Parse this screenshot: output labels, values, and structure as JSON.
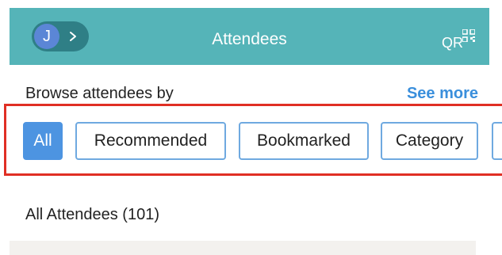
{
  "header": {
    "avatar_initial": "J",
    "title": "Attendees",
    "qr_label": "QR"
  },
  "browse": {
    "heading": "Browse attendees by",
    "see_more": "See more",
    "filters": [
      {
        "label": "All",
        "active": true
      },
      {
        "label": "Recommended",
        "active": false
      },
      {
        "label": "Bookmarked",
        "active": false
      },
      {
        "label": "Category",
        "active": false
      }
    ]
  },
  "list": {
    "title": "All Attendees (101)"
  },
  "colors": {
    "header_bg": "#55b4b8",
    "accent": "#4d94e1",
    "link": "#3a8fdc",
    "highlight": "#e02f24"
  }
}
